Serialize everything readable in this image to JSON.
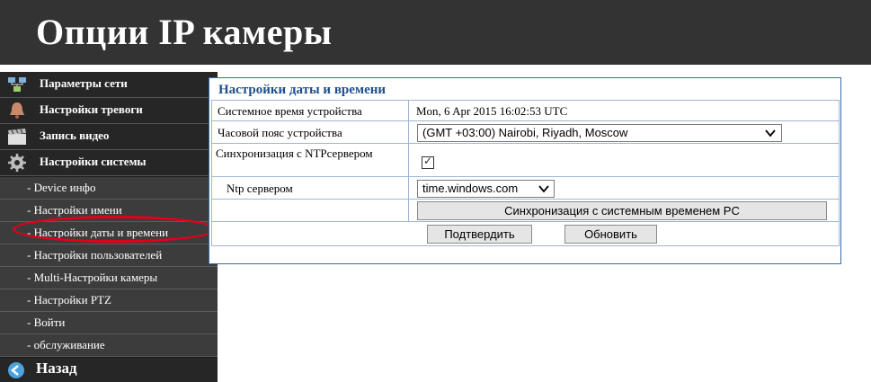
{
  "app": {
    "title": "Опции IP камеры"
  },
  "sidebar": {
    "main_items": [
      {
        "label": "Параметры сети",
        "icon": "network-icon"
      },
      {
        "label": "Настройки тревоги",
        "icon": "alarm-bell-icon"
      },
      {
        "label": "Запись видео",
        "icon": "video-clapper-icon"
      },
      {
        "label": "Настройки системы",
        "icon": "gear-icon"
      }
    ],
    "sub_items": [
      {
        "label": "- Device инфо"
      },
      {
        "label": "- Настройки имени"
      },
      {
        "label": "- Настройки даты и времени"
      },
      {
        "label": "- Настройки пользователей"
      },
      {
        "label": "- Multi-Настройки камеры"
      },
      {
        "label": "- Настройки PTZ"
      },
      {
        "label": "- Войти"
      },
      {
        "label": "- обслуживание"
      }
    ],
    "back": {
      "label": "Назад",
      "icon": "back-arrow-icon"
    }
  },
  "panel": {
    "title": "Настройки даты и времени",
    "rows": {
      "system_time_label": "Системное время устройства",
      "system_time_value": "Mon, 6 Apr 2015 16:02:53 UTC",
      "timezone_label": "Часовой пояс устройства",
      "timezone_value": "(GMT +03:00) Nairobi, Riyadh, Moscow",
      "ntp_sync_label": "Синхронизация с NTPсервером",
      "ntp_sync_checked": true,
      "ntp_server_label": "Ntp сервером",
      "ntp_server_value": "time.windows.com",
      "sync_pc_button": "Синхронизация с системным временем PC"
    },
    "buttons": {
      "confirm": "Подтвердить",
      "refresh": "Обновить"
    }
  },
  "colors": {
    "header_bg": "#333333",
    "sidebar_bg": "#262626",
    "panel_title": "#1e4e8c",
    "highlight": "#e2001a"
  }
}
